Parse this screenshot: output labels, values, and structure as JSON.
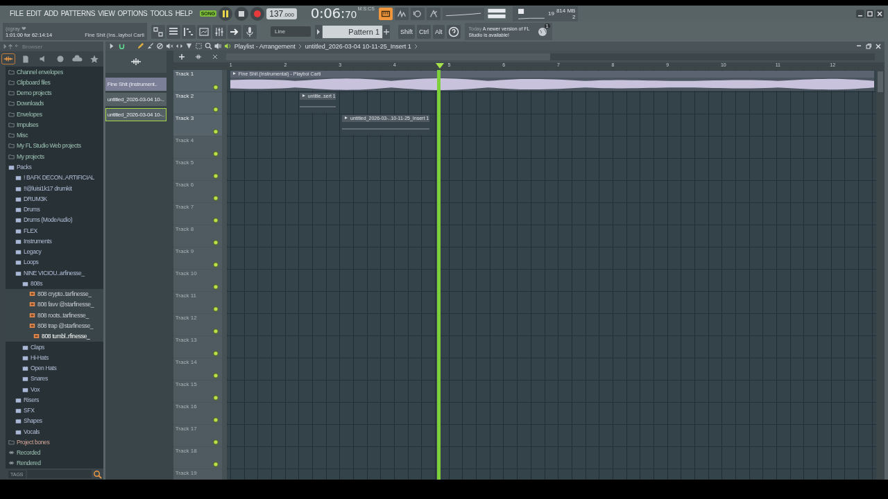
{
  "menu": [
    "FILE",
    "EDIT",
    "ADD",
    "PATTERNS",
    "VIEW",
    "OPTIONS",
    "TOOLS",
    "HELP"
  ],
  "transport": {
    "mode": "SONG",
    "song_mode": true,
    "recording": true,
    "tempo": "137",
    "tempo_decimals": ".000",
    "time": "0:06:",
    "time_cs": "70",
    "time_unit": "M:S:CS"
  },
  "monitor": {
    "cpu": "19",
    "memory": "814 MB",
    "polyphony": "2"
  },
  "hint": {
    "title": "(cgray ❤",
    "position": "1:01:00 for 62:14:14",
    "song": "Fine Shit (Ins..layboi Carti"
  },
  "snap": "Line",
  "pattern": "Pattern 1",
  "modifiers": [
    "Shift",
    "Ctrl",
    "Alt"
  ],
  "news": {
    "day": "Today",
    "message": "A newer version of FL Studio is available!",
    "count": "1"
  },
  "browser": {
    "title": "Browser",
    "tags_label": "TAGS",
    "items": [
      {
        "kind": "folder",
        "label": "Channel envelopes"
      },
      {
        "kind": "folder",
        "label": "Clipboard files"
      },
      {
        "kind": "folder",
        "label": "Demo projects"
      },
      {
        "kind": "folder",
        "label": "Downloads"
      },
      {
        "kind": "folder",
        "label": "Envelopes"
      },
      {
        "kind": "folder",
        "label": "Impulses"
      },
      {
        "kind": "folder",
        "label": "Misc"
      },
      {
        "kind": "folder",
        "label": "My FL Studio Web projects"
      },
      {
        "kind": "folder",
        "label": "My projects"
      },
      {
        "kind": "pack",
        "label": "Packs",
        "children": [
          {
            "kind": "pack",
            "label": "!  BAFK DECON..ARTIFICIAL"
          },
          {
            "kind": "pack",
            "label": "!!@luisi1k17 drumkit"
          },
          {
            "kind": "pack",
            "label": "DRUM3K"
          },
          {
            "kind": "pack",
            "label": "Drums"
          },
          {
            "kind": "pack",
            "label": "Drums (ModeAudio)"
          },
          {
            "kind": "pack",
            "label": "FLEX"
          },
          {
            "kind": "pack",
            "label": "Instruments"
          },
          {
            "kind": "pack",
            "label": "Legacy"
          },
          {
            "kind": "pack",
            "label": "Loops"
          },
          {
            "kind": "pack",
            "label": "NINE VICIOU..arfinesse_",
            "children": [
              {
                "kind": "pack",
                "label": "808s",
                "children": [
                  {
                    "kind": "audio",
                    "label": "808 crypto..tarfinesse_",
                    "selected": false
                  },
                  {
                    "kind": "audio",
                    "label": "808 favv @starfinesse_",
                    "selected": false
                  },
                  {
                    "kind": "audio",
                    "label": "808 roots..tarfinesse_",
                    "selected": false
                  },
                  {
                    "kind": "audio",
                    "label": "808 trap @starfinesse_",
                    "selected": false
                  },
                  {
                    "kind": "audio",
                    "label": "808 tumbl..rfinesse_",
                    "selected": true
                  }
                ]
              },
              {
                "kind": "pack",
                "label": "Claps"
              },
              {
                "kind": "pack",
                "label": "Hi-Hats"
              },
              {
                "kind": "pack",
                "label": "Open Hats"
              },
              {
                "kind": "pack",
                "label": "Snares"
              },
              {
                "kind": "pack",
                "label": "Vox"
              }
            ]
          },
          {
            "kind": "pack",
            "label": "Risers"
          },
          {
            "kind": "pack",
            "label": "SFX"
          },
          {
            "kind": "pack",
            "label": "Shapes"
          },
          {
            "kind": "pack",
            "label": "Vocals"
          }
        ]
      },
      {
        "kind": "project",
        "label": "Project bones"
      },
      {
        "kind": "recorded",
        "label": "Recorded"
      },
      {
        "kind": "rendered",
        "label": "Rendered"
      }
    ]
  },
  "playlist": {
    "title": "Playlist - Arrangement",
    "path": "untitled_2026-03-04 10-11-25_Insert 1",
    "clip_sources": [
      {
        "label": "Fine Shit (Instrument..",
        "selected": false
      },
      {
        "label": "untitled_2026-03-04 10-..",
        "selected": false
      },
      {
        "label": "untitled_2026-03-04 10-..",
        "selected": true
      }
    ],
    "ruler": [
      "1",
      "2",
      "3",
      "4",
      "5",
      "6",
      "7",
      "8",
      "9",
      "10",
      "11",
      "12"
    ],
    "tracks": [
      {
        "name": "Track 1",
        "empty": false,
        "clips": [
          {
            "label": "Fine Shit (Instrumental) - Playboi Carti"
          }
        ]
      },
      {
        "name": "Track 2",
        "empty": false,
        "clips": [
          {
            "label": "untitle..sert 1"
          }
        ]
      },
      {
        "name": "Track 3",
        "empty": false,
        "clips": [
          {
            "label": "untitled_2026-03-..10-11-25_Insert 1"
          }
        ]
      },
      {
        "name": "Track 4",
        "empty": true
      },
      {
        "name": "Track 5",
        "empty": true
      },
      {
        "name": "Track 6",
        "empty": true
      },
      {
        "name": "Track 7",
        "empty": true
      },
      {
        "name": "Track 8",
        "empty": true
      },
      {
        "name": "Track 9",
        "empty": true
      },
      {
        "name": "Track 10",
        "empty": true
      },
      {
        "name": "Track 11",
        "empty": true
      },
      {
        "name": "Track 12",
        "empty": true
      },
      {
        "name": "Track 13",
        "empty": true
      },
      {
        "name": "Track 14",
        "empty": true
      },
      {
        "name": "Track 15",
        "empty": true
      },
      {
        "name": "Track 16",
        "empty": true
      },
      {
        "name": "Track 17",
        "empty": true
      },
      {
        "name": "Track 18",
        "empty": true
      },
      {
        "name": "Track 19",
        "empty": true
      }
    ]
  }
}
